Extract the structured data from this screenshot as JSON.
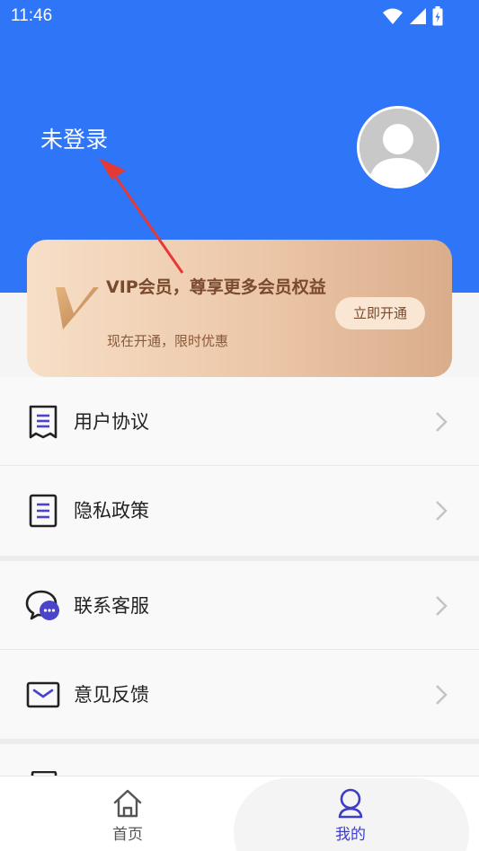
{
  "status_bar": {
    "time": "11:46",
    "icons": [
      "wifi-icon",
      "signal-icon",
      "battery-charging-icon"
    ]
  },
  "header": {
    "background_color": "#2f75f7",
    "login_status": "未登录",
    "avatar_icon": "default-user-avatar-icon"
  },
  "vip_card": {
    "title": "VIP会员，尊享更多会员权益",
    "subtitle": "现在开通，限时优惠",
    "button_label": "立即开通"
  },
  "menu": {
    "items": [
      {
        "label": "用户协议",
        "icon": "agreement-document-icon"
      },
      {
        "label": "隐私政策",
        "icon": "privacy-document-icon"
      },
      {
        "label": "联系客服",
        "icon": "customer-service-chat-icon"
      },
      {
        "label": "意见反馈",
        "icon": "feedback-mail-icon"
      }
    ]
  },
  "tabbar": {
    "tabs": [
      {
        "label": "首页",
        "icon": "home-icon",
        "active": false
      },
      {
        "label": "我的",
        "icon": "user-profile-icon",
        "active": true
      }
    ],
    "active_color": "#3f3cc7"
  }
}
